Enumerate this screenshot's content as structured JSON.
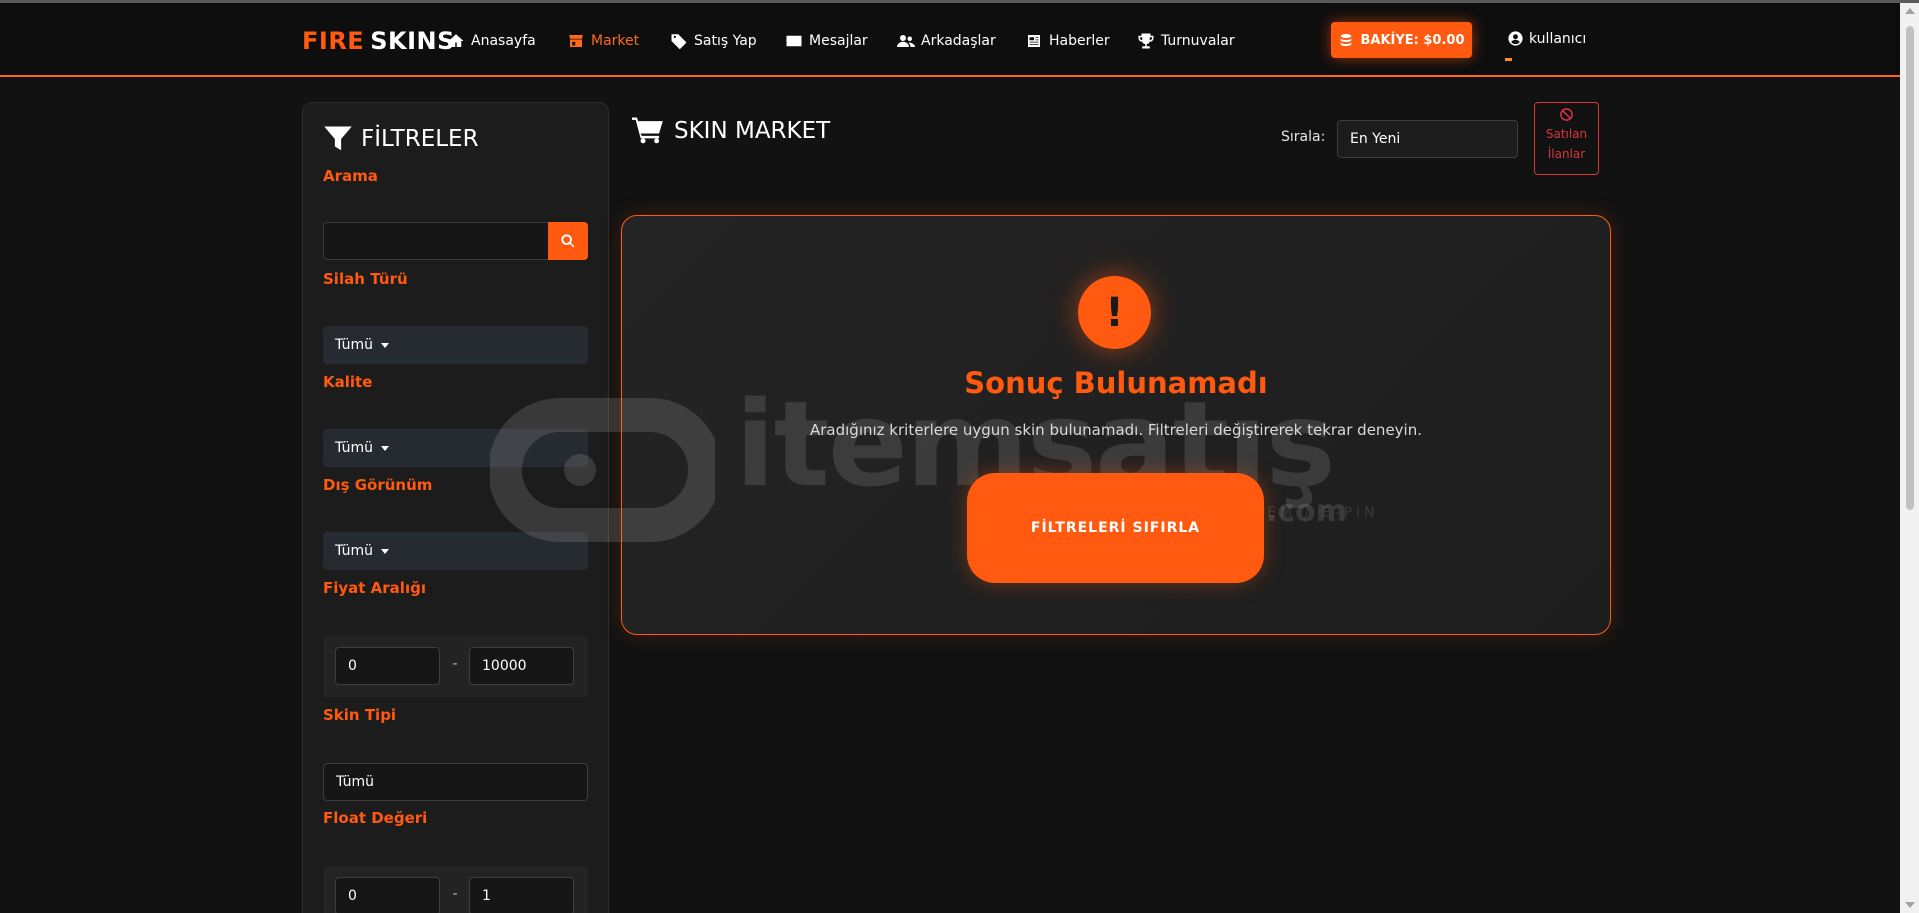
{
  "brand": {
    "fire": "FIRE",
    "skins": "SKINS"
  },
  "nav": {
    "items": [
      {
        "label": "Anasayfa",
        "icon": "home-icon"
      },
      {
        "label": "Market",
        "icon": "store-icon",
        "active": true
      },
      {
        "label": "Satış Yap",
        "icon": "tag-icon"
      },
      {
        "label": "Mesajlar",
        "icon": "envelope-icon"
      },
      {
        "label": "Arkadaşlar",
        "icon": "users-icon"
      },
      {
        "label": "Haberler",
        "icon": "newspaper-icon"
      },
      {
        "label": "Turnuvalar",
        "icon": "trophy-icon"
      }
    ],
    "balance_label": "BAKİYE: $0.00",
    "user_label": "kullanıcı"
  },
  "sidebar": {
    "title": "FİLTRELER",
    "search_label": "Arama",
    "search_value": "",
    "weapon_label": "Silah Türü",
    "weapon_value": "Tümü",
    "quality_label": "Kalite",
    "quality_value": "Tümü",
    "exterior_label": "Dış Görünüm",
    "exterior_value": "Tümü",
    "price_label": "Fiyat Aralığı",
    "price_min": "0",
    "price_max": "10000",
    "skin_type_label": "Skin Tipi",
    "skin_type_value": "Tümü",
    "float_label": "Float Değeri",
    "float_min": "0",
    "float_max": "1",
    "range_dash": "-"
  },
  "main": {
    "title": "SKIN MARKET",
    "sort_label": "Sırala:",
    "sort_value": "En Yeni",
    "sold_line1": "Satılan",
    "sold_line2": "İlanlar",
    "empty_icon": "!",
    "empty_title": "Sonuç Bulunamadı",
    "empty_text": "Aradığınız kriterlere uygun skin bulunamadı. Filtreleri değiştirerek tekrar deneyin.",
    "reset_label": "FİLTRELERİ SIFIRLA"
  },
  "watermark": {
    "text": "itemsatış",
    "sub": "HESAP / SKIN / ITEM / E-PIN",
    "com": ".com"
  },
  "colors": {
    "accent": "#ff5a0f",
    "danger": "#d9363e",
    "background": "#121212",
    "panel": "#1c1c1c"
  }
}
